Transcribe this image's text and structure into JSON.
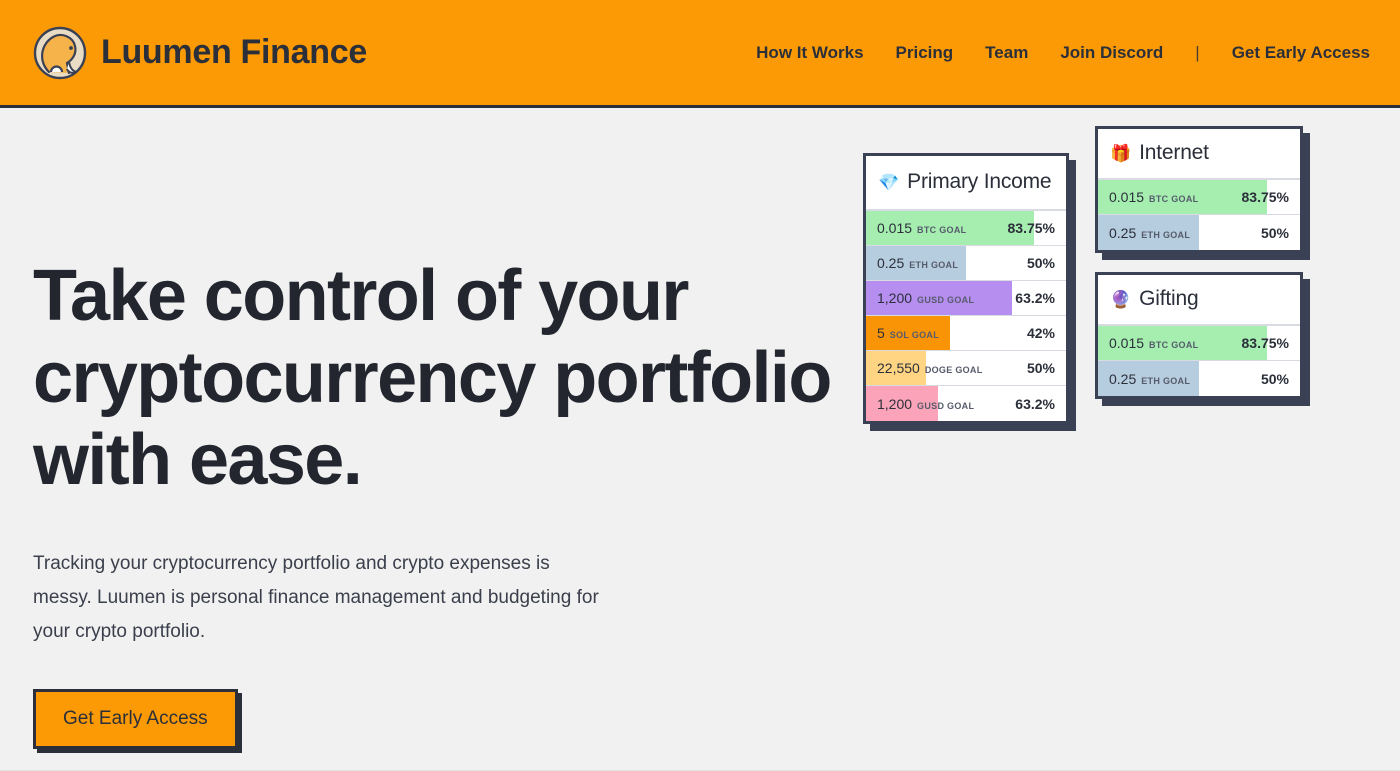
{
  "header": {
    "logo_icon": "elephant-logo-icon",
    "brand_name": "Luumen Finance",
    "nav": [
      {
        "label": "How It Works",
        "name": "how-it-works"
      },
      {
        "label": "Pricing",
        "name": "pricing"
      },
      {
        "label": "Team",
        "name": "team"
      },
      {
        "label": "Join Discord",
        "name": "join-discord"
      }
    ],
    "separator": "|",
    "cta_label": "Get Early Access",
    "background_color": "#fb9a05",
    "text_color": "#2b2f3a"
  },
  "hero": {
    "title": "Take control of your cryptocurrency portfolio with ease.",
    "subtitle": "Tracking your cryptocurrency portfolio and crypto expenses is messy. Luumen is personal finance management and budgeting for your crypto portfolio.",
    "cta_label": "Get Early Access",
    "cta_background": "#fb9a05",
    "page_background": "#f1f1f1"
  },
  "cards": [
    {
      "name": "primary-income",
      "emoji": "💎",
      "emoji_name": "diamond-icon",
      "title": "Primary Income",
      "rows": [
        {
          "amount": "0.015",
          "unit": "BTC GOAL",
          "percent": "83.75%",
          "fill": 83.75,
          "color": "#a5eeb0"
        },
        {
          "amount": "0.25",
          "unit": "ETH GOAL",
          "percent": "50%",
          "fill": 50,
          "color": "#b6ccdf"
        },
        {
          "amount": "1,200",
          "unit": "GUSD GOAL",
          "percent": "63.2%",
          "fill": 73,
          "color": "#b68ef0"
        },
        {
          "amount": "5",
          "unit": "SOL GOAL",
          "percent": "42%",
          "fill": 42,
          "color": "#f89406"
        },
        {
          "amount": "22,550",
          "unit": "DOGE GOAL",
          "percent": "50%",
          "fill": 30,
          "color": "#ffd482"
        },
        {
          "amount": "1,200",
          "unit": "GUSD GOAL",
          "percent": "63.2%",
          "fill": 36,
          "color": "#fba4b9"
        }
      ]
    },
    {
      "name": "internet",
      "emoji": "🎁",
      "emoji_name": "gift-icon",
      "title": "Internet",
      "rows": [
        {
          "amount": "0.015",
          "unit": "BTC GOAL",
          "percent": "83.75%",
          "fill": 83.75,
          "color": "#a5eeb0"
        },
        {
          "amount": "0.25",
          "unit": "ETH GOAL",
          "percent": "50%",
          "fill": 50,
          "color": "#b6ccdf"
        }
      ]
    },
    {
      "name": "gifting",
      "emoji": "🔮",
      "emoji_name": "crystal-ball-icon",
      "title": "Gifting",
      "rows": [
        {
          "amount": "0.015",
          "unit": "BTC GOAL",
          "percent": "83.75%",
          "fill": 83.75,
          "color": "#a5eeb0"
        },
        {
          "amount": "0.25",
          "unit": "ETH GOAL",
          "percent": "50%",
          "fill": 50,
          "color": "#b6ccdf"
        }
      ]
    }
  ]
}
